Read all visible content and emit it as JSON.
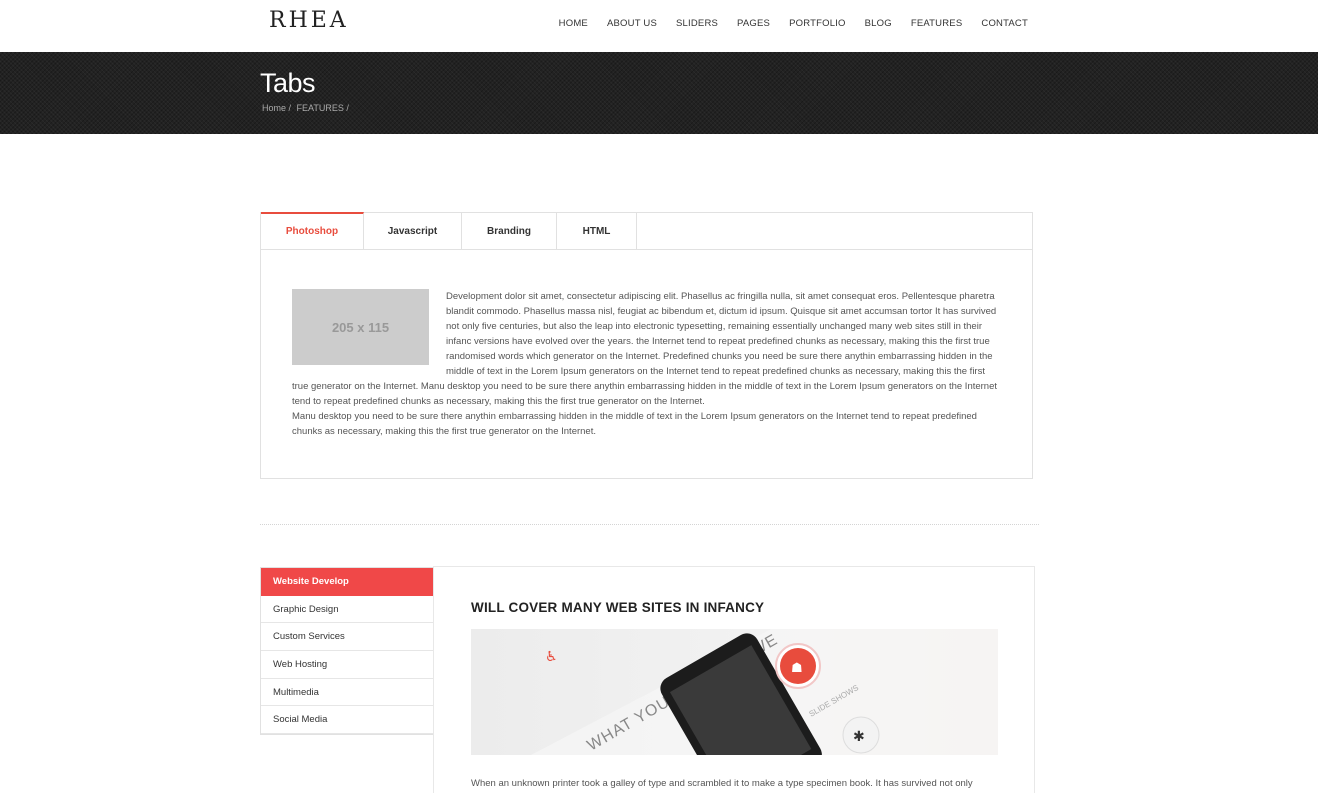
{
  "header": {
    "logo": "RHEA",
    "nav": [
      "HOME",
      "ABOUT US",
      "SLIDERS",
      "PAGES",
      "PORTFOLIO",
      "BLOG",
      "FEATURES",
      "CONTACT"
    ]
  },
  "titlebar": {
    "title": "Tabs",
    "breadcrumb": [
      "Home /",
      "FEATURES /"
    ]
  },
  "tabs": {
    "items": [
      "Photoshop",
      "Javascript",
      "Branding",
      "HTML"
    ],
    "active": "Photoshop",
    "placeholder_label": "205 x 115",
    "content_1": "Development dolor sit amet, consectetur adipiscing elit. Phasellus ac fringilla nulla, sit amet consequat eros. Pellentesque pharetra blandit commodo. Phasellus massa nisl, feugiat ac bibendum et, dictum id ipsum. Quisque sit amet accumsan tortor It has survived not only five centuries, but also the leap into electronic typesetting, remaining essentially unchanged many web sites still in their infanc versions have evolved over the years. the Internet tend to repeat predefined chunks as necessary, making this the first true randomised words which generator on the Internet. Predefined chunks you need be sure there anythin embarrassing hidden in the middle of text in the Lorem Ipsum generators on the Internet tend to repeat predefined chunks as necessary, making this the first true generator on the Internet. Manu desktop you need to be sure there anythin embarrassing hidden in the middle of text in the Lorem Ipsum generators on the Internet tend to repeat predefined chunks as necessary, making this the first true generator on the Internet.",
    "content_2": "Manu desktop you need to be sure there anythin embarrassing hidden in the middle of text in the Lorem Ipsum generators on the Internet tend to repeat predefined chunks as necessary, making this the first true generator on the Internet."
  },
  "vtabs": {
    "items": [
      "Website Develop",
      "Graphic Design",
      "Custom Services",
      "Web Hosting",
      "Multimedia",
      "Social Media"
    ],
    "active": "Website Develop",
    "panel_title": "WILL COVER MANY WEB SITES IN INFANCY",
    "panel_text": "When an unknown printer took a galley of type and scrambled it to make a type specimen book. It has survived not only",
    "image_texts": {
      "what_you_get": "WHAT YOU GET WITH WE",
      "slide_shows": "SLIDE SHOWS"
    }
  },
  "colors": {
    "accent": "#e84c3d",
    "vtab_active": "#f04848",
    "band": "#222222"
  }
}
